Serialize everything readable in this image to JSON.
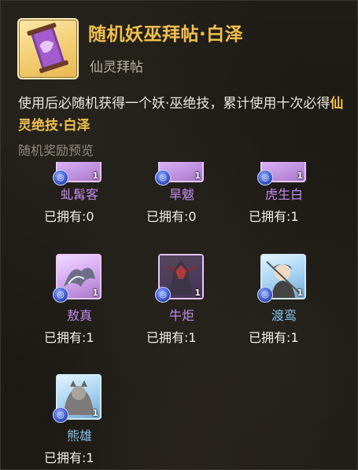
{
  "item": {
    "title": "随机妖巫拜帖·白泽",
    "subtitle": "仙灵拜帖",
    "desc_prefix": "使用后必随机获得一个妖·巫绝技，累计使用十次必得",
    "desc_highlight": "仙灵绝技·白泽",
    "icon": "invitation-scroll-icon"
  },
  "section_label": "随机奖励预览",
  "colors": {
    "title_gold": "#f1c04d",
    "purple_quality": "#c48af1",
    "blue_quality": "#83c1ea"
  },
  "rewards": [
    {
      "name": "虬髯客",
      "owned": "已拥有:0",
      "count": "1",
      "quality": "purple"
    },
    {
      "name": "旱魃",
      "owned": "已拥有:0",
      "count": "1",
      "quality": "purple"
    },
    {
      "name": "虎生白",
      "owned": "已拥有:1",
      "count": "1",
      "quality": "purple"
    },
    {
      "name": "敖真",
      "owned": "已拥有:1",
      "count": "1",
      "quality": "purple"
    },
    {
      "name": "牛炬",
      "owned": "已拥有:1",
      "count": "1",
      "quality": "purple"
    },
    {
      "name": "渡鸾",
      "owned": "已拥有:1",
      "count": "1",
      "quality": "blue"
    },
    {
      "name": "熊雄",
      "owned": "已拥有:1",
      "count": "1",
      "quality": "blue"
    }
  ]
}
